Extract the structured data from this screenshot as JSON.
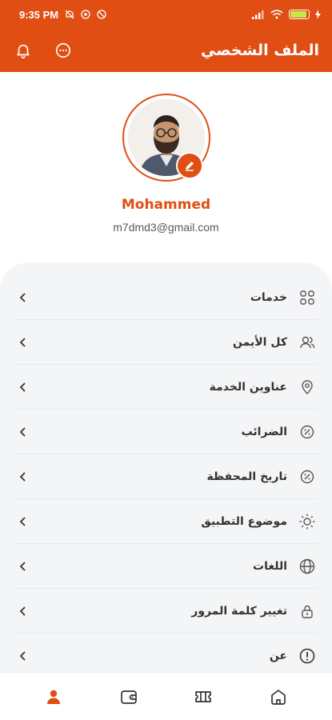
{
  "status_bar": {
    "time": "9:35 PM",
    "battery_level": 0.85,
    "battery_color": "#c7e84a"
  },
  "app_bar": {
    "title": "الملف الشخصي",
    "icons": [
      "bell-icon",
      "chat-icon"
    ]
  },
  "profile": {
    "name": "Mohammed",
    "email": "m7dmd3@gmail.com",
    "edit_icon": "pencil-icon"
  },
  "menu": [
    {
      "label": "خدمات",
      "icon": "grid-icon"
    },
    {
      "label": "كل الأيمن",
      "icon": "users-icon"
    },
    {
      "label": "عناوين الخدمة",
      "icon": "location-pin-icon"
    },
    {
      "label": "الضرائب",
      "icon": "tax-icon"
    },
    {
      "label": "تاريخ المحفظة",
      "icon": "wallet-history-icon"
    },
    {
      "label": "موضوع التطبيق",
      "icon": "sun-icon"
    },
    {
      "label": "اللغات",
      "icon": "globe-icon"
    },
    {
      "label": "تغيير كلمة المرور",
      "icon": "lock-icon"
    },
    {
      "label": "عن",
      "icon": "info-icon"
    }
  ],
  "bottom_nav": {
    "items": [
      "profile-icon",
      "wallet-icon",
      "ticket-icon",
      "home-icon"
    ],
    "active": "profile-icon"
  },
  "colors": {
    "brand": "#e04e14",
    "menu_background": "#f4f5f7"
  }
}
